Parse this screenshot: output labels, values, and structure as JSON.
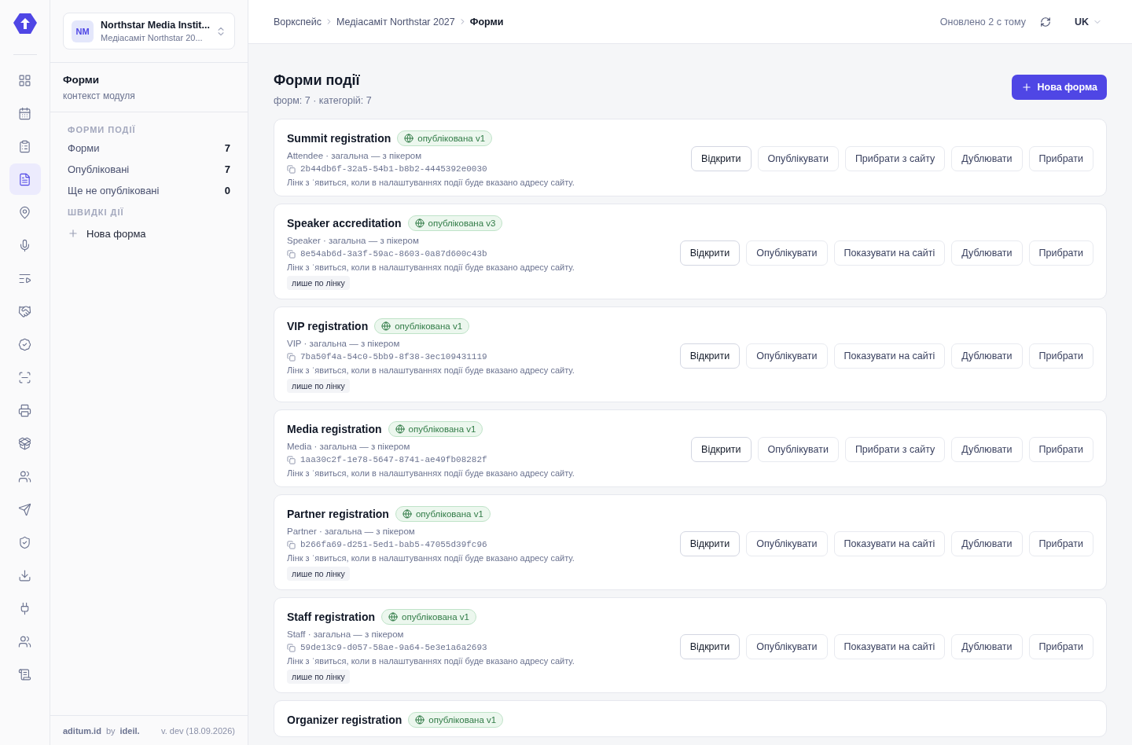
{
  "nav_rail": [
    {
      "kind": "grid",
      "selected": false
    },
    {
      "kind": "calendar",
      "selected": false
    },
    {
      "kind": "clipboard",
      "selected": false
    },
    {
      "kind": "file",
      "selected": true
    },
    {
      "kind": "pin",
      "selected": false
    },
    {
      "kind": "mic",
      "selected": false
    },
    {
      "kind": "list",
      "selected": false
    },
    {
      "kind": "handshake",
      "selected": false
    },
    {
      "kind": "badge",
      "selected": false
    },
    {
      "kind": "scan",
      "selected": false
    },
    {
      "kind": "printer",
      "selected": false
    },
    {
      "kind": "package",
      "selected": false
    },
    {
      "kind": "users",
      "selected": false
    },
    {
      "kind": "send",
      "selected": false
    },
    {
      "kind": "shield",
      "selected": false
    },
    {
      "kind": "download",
      "selected": false
    },
    {
      "kind": "plug",
      "selected": false
    },
    {
      "kind": "users",
      "selected": false
    },
    {
      "kind": "scroll",
      "selected": false
    }
  ],
  "workspace": {
    "initials": "NM",
    "name": "Northstar Media Instit...",
    "event": "Медіасаміт Northstar 20..."
  },
  "module": {
    "title": "Форми",
    "subtitle": "контекст модуля"
  },
  "sidebar": {
    "sections": [
      {
        "heading": "ФОРМИ ПОДІЇ",
        "items": [
          {
            "label": "Форми",
            "count": "7"
          },
          {
            "label": "Опубліковані",
            "count": "7"
          },
          {
            "label": "Ще не опубліковані",
            "count": "0"
          }
        ]
      },
      {
        "heading": "ШВИДКІ ДІЇ",
        "items": [
          {
            "label": "Нова форма",
            "kind": "action"
          }
        ]
      }
    ]
  },
  "footer": {
    "brand": "aditum.id",
    "by": "by",
    "maker": "ideil.",
    "version": "v. dev (18.09.2026)"
  },
  "breadcrumbs": [
    {
      "label": "Воркспейс",
      "current": false
    },
    {
      "label": "Медіасаміт Northstar 2027",
      "current": false
    },
    {
      "label": "Форми",
      "current": true
    }
  ],
  "topbar": {
    "updated": "Оновлено 2 с тому",
    "language": "UK"
  },
  "page": {
    "title": "Форми події",
    "summary": "форм: 7 · категорій: 7",
    "new_button": "Нова форма"
  },
  "forms": [
    {
      "title": "Summit registration",
      "status": "опублікована v1",
      "meta": "Attendee · загальна — з пікером",
      "id": "2b44db6f-32a5-54b1-b8b2-4445392e0030",
      "note": "Лінк з ˈявиться, коли в налаштуваннях події буде вказано адресу сайту.",
      "actions": [
        "Відкрити",
        "Опублікувати",
        "Прибрати з сайту",
        "Дублювати",
        "Прибрати"
      ]
    },
    {
      "title": "Speaker accreditation",
      "status": "опублікована v3",
      "meta": "Speaker · загальна — з пікером",
      "id": "8e54ab6d-3a3f-59ac-8603-0a87d600c43b",
      "note": "Лінк з ˈявиться, коли в налаштуваннях події буде вказано адресу сайту.",
      "tag": "лише по лінку",
      "actions": [
        "Відкрити",
        "Опублікувати",
        "Показувати на сайті",
        "Дублювати",
        "Прибрати"
      ]
    },
    {
      "title": "VIP registration",
      "status": "опублікована v1",
      "meta": "VIP · загальна — з пікером",
      "id": "7ba50f4a-54c0-5bb9-8f38-3ec109431119",
      "note": "Лінк з ˈявиться, коли в налаштуваннях події буде вказано адресу сайту.",
      "tag": "лише по лінку",
      "actions": [
        "Відкрити",
        "Опублікувати",
        "Показувати на сайті",
        "Дублювати",
        "Прибрати"
      ]
    },
    {
      "title": "Media registration",
      "status": "опублікована v1",
      "meta": "Media · загальна — з пікером",
      "id": "1aa30c2f-1e78-5647-8741-ae49fb08282f",
      "note": "Лінк з ˈявиться, коли в налаштуваннях події буде вказано адресу сайту.",
      "actions": [
        "Відкрити",
        "Опублікувати",
        "Прибрати з сайту",
        "Дублювати",
        "Прибрати"
      ]
    },
    {
      "title": "Partner registration",
      "status": "опублікована v1",
      "meta": "Partner · загальна — з пікером",
      "id": "b266fa69-d251-5ed1-bab5-47055d39fc96",
      "note": "Лінк з ˈявиться, коли в налаштуваннях події буде вказано адресу сайту.",
      "tag": "лише по лінку",
      "actions": [
        "Відкрити",
        "Опублікувати",
        "Показувати на сайті",
        "Дублювати",
        "Прибрати"
      ]
    },
    {
      "title": "Staff registration",
      "status": "опублікована v1",
      "meta": "Staff · загальна — з пікером",
      "id": "59de13c9-d057-58ae-9a64-5e3e1a6a2693",
      "note": "Лінк з ˈявиться, коли в налаштуваннях події буде вказано адресу сайту.",
      "tag": "лише по лінку",
      "actions": [
        "Відкрити",
        "Опублікувати",
        "Показувати на сайті",
        "Дублювати",
        "Прибрати"
      ]
    },
    {
      "title": "Organizer registration",
      "status": "опублікована v1"
    }
  ]
}
